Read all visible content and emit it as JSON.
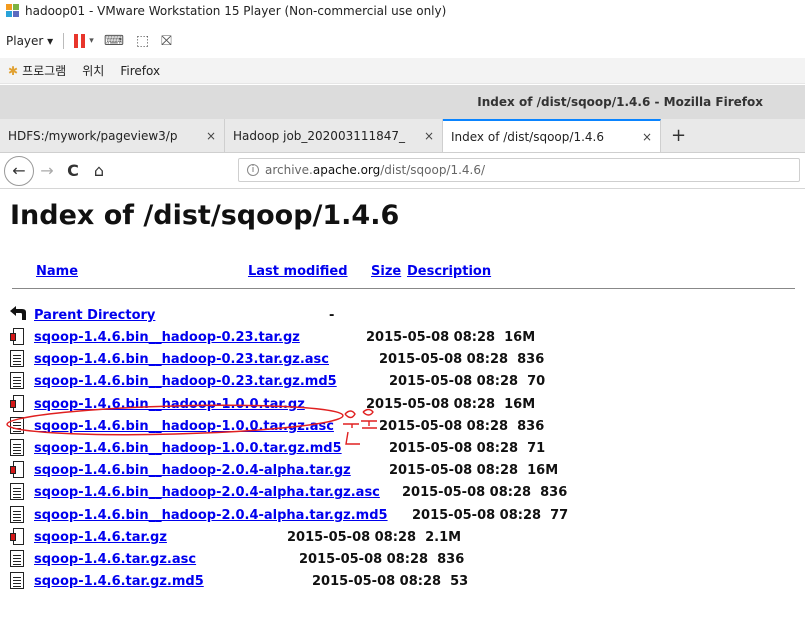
{
  "vmware": {
    "title": "hadoop01 - VMware Workstation 15 Player (Non-commercial use only)",
    "player_menu": "Player ▾",
    "icons": [
      "vmware-logo-icon",
      "pause-icon",
      "send-ctrl-alt-del-icon",
      "fit-guest-icon",
      "unity-icon"
    ]
  },
  "guest_menu": {
    "items": [
      "프로그램",
      "위치",
      "Firefox"
    ]
  },
  "firefox": {
    "window_title": "Index of /dist/sqoop/1.4.6 - Mozilla Firefox",
    "tabs": [
      {
        "label": "HDFS:/mywork/pageview3/p",
        "close": "×",
        "active": false
      },
      {
        "label": "Hadoop job_202003111847_",
        "close": "×",
        "active": false
      },
      {
        "label": "Index of /dist/sqoop/1.4.6",
        "close": "×",
        "active": true
      }
    ],
    "new_tab": "+",
    "nav": {
      "back": "←",
      "forward": "→",
      "reload": "C",
      "home": "⌂"
    },
    "url": {
      "prefix": "archive.",
      "domain": "apache.org",
      "path": "/dist/sqoop/1.4.6/"
    }
  },
  "page": {
    "heading": "Index of /dist/sqoop/1.4.6",
    "columns": {
      "name": "Name",
      "last_modified": "Last modified",
      "size": "Size",
      "description": "Description"
    },
    "parent": {
      "name": "Parent Directory",
      "meta": "-"
    },
    "files": [
      {
        "name": "sqoop-1.4.6.bin__hadoop-0.23.tar.gz",
        "meta": "2015-05-08 08:28  16M",
        "icon": "archive-icon"
      },
      {
        "name": "sqoop-1.4.6.bin__hadoop-0.23.tar.gz.asc",
        "meta": "2015-05-08 08:28  836",
        "icon": "document-icon"
      },
      {
        "name": "sqoop-1.4.6.bin__hadoop-0.23.tar.gz.md5",
        "meta": "2015-05-08 08:28  70",
        "icon": "document-icon"
      },
      {
        "name": "sqoop-1.4.6.bin__hadoop-1.0.0.tar.gz",
        "meta": "2015-05-08 08:28  16M",
        "icon": "archive-icon"
      },
      {
        "name": "sqoop-1.4.6.bin__hadoop-1.0.0.tar.gz.asc",
        "meta": "2015-05-08 08:28  836",
        "icon": "document-icon"
      },
      {
        "name": "sqoop-1.4.6.bin__hadoop-1.0.0.tar.gz.md5",
        "meta": "2015-05-08 08:28  71",
        "icon": "document-icon"
      },
      {
        "name": "sqoop-1.4.6.bin__hadoop-2.0.4-alpha.tar.gz",
        "meta": "2015-05-08 08:28  16M",
        "icon": "archive-icon"
      },
      {
        "name": "sqoop-1.4.6.bin__hadoop-2.0.4-alpha.tar.gz.asc",
        "meta": "2015-05-08 08:28  836",
        "icon": "document-icon"
      },
      {
        "name": "sqoop-1.4.6.bin__hadoop-2.0.4-alpha.tar.gz.md5",
        "meta": "2015-05-08 08:28  77",
        "icon": "document-icon"
      },
      {
        "name": "sqoop-1.4.6.tar.gz",
        "meta": "2015-05-08 08:28  2.1M",
        "icon": "archive-icon"
      },
      {
        "name": "sqoop-1.4.6.tar.gz.asc",
        "meta": "2015-05-08 08:28  836",
        "icon": "document-icon"
      },
      {
        "name": "sqoop-1.4.6.tar.gz.md5",
        "meta": "2015-05-08 08:28  53",
        "icon": "document-icon"
      }
    ]
  },
  "annotation": {
    "handwritten_text": "오른쪽",
    "color": "#e02020",
    "highlighted_file": "sqoop-1.4.6.bin__hadoop-1.0.0.tar.gz"
  }
}
